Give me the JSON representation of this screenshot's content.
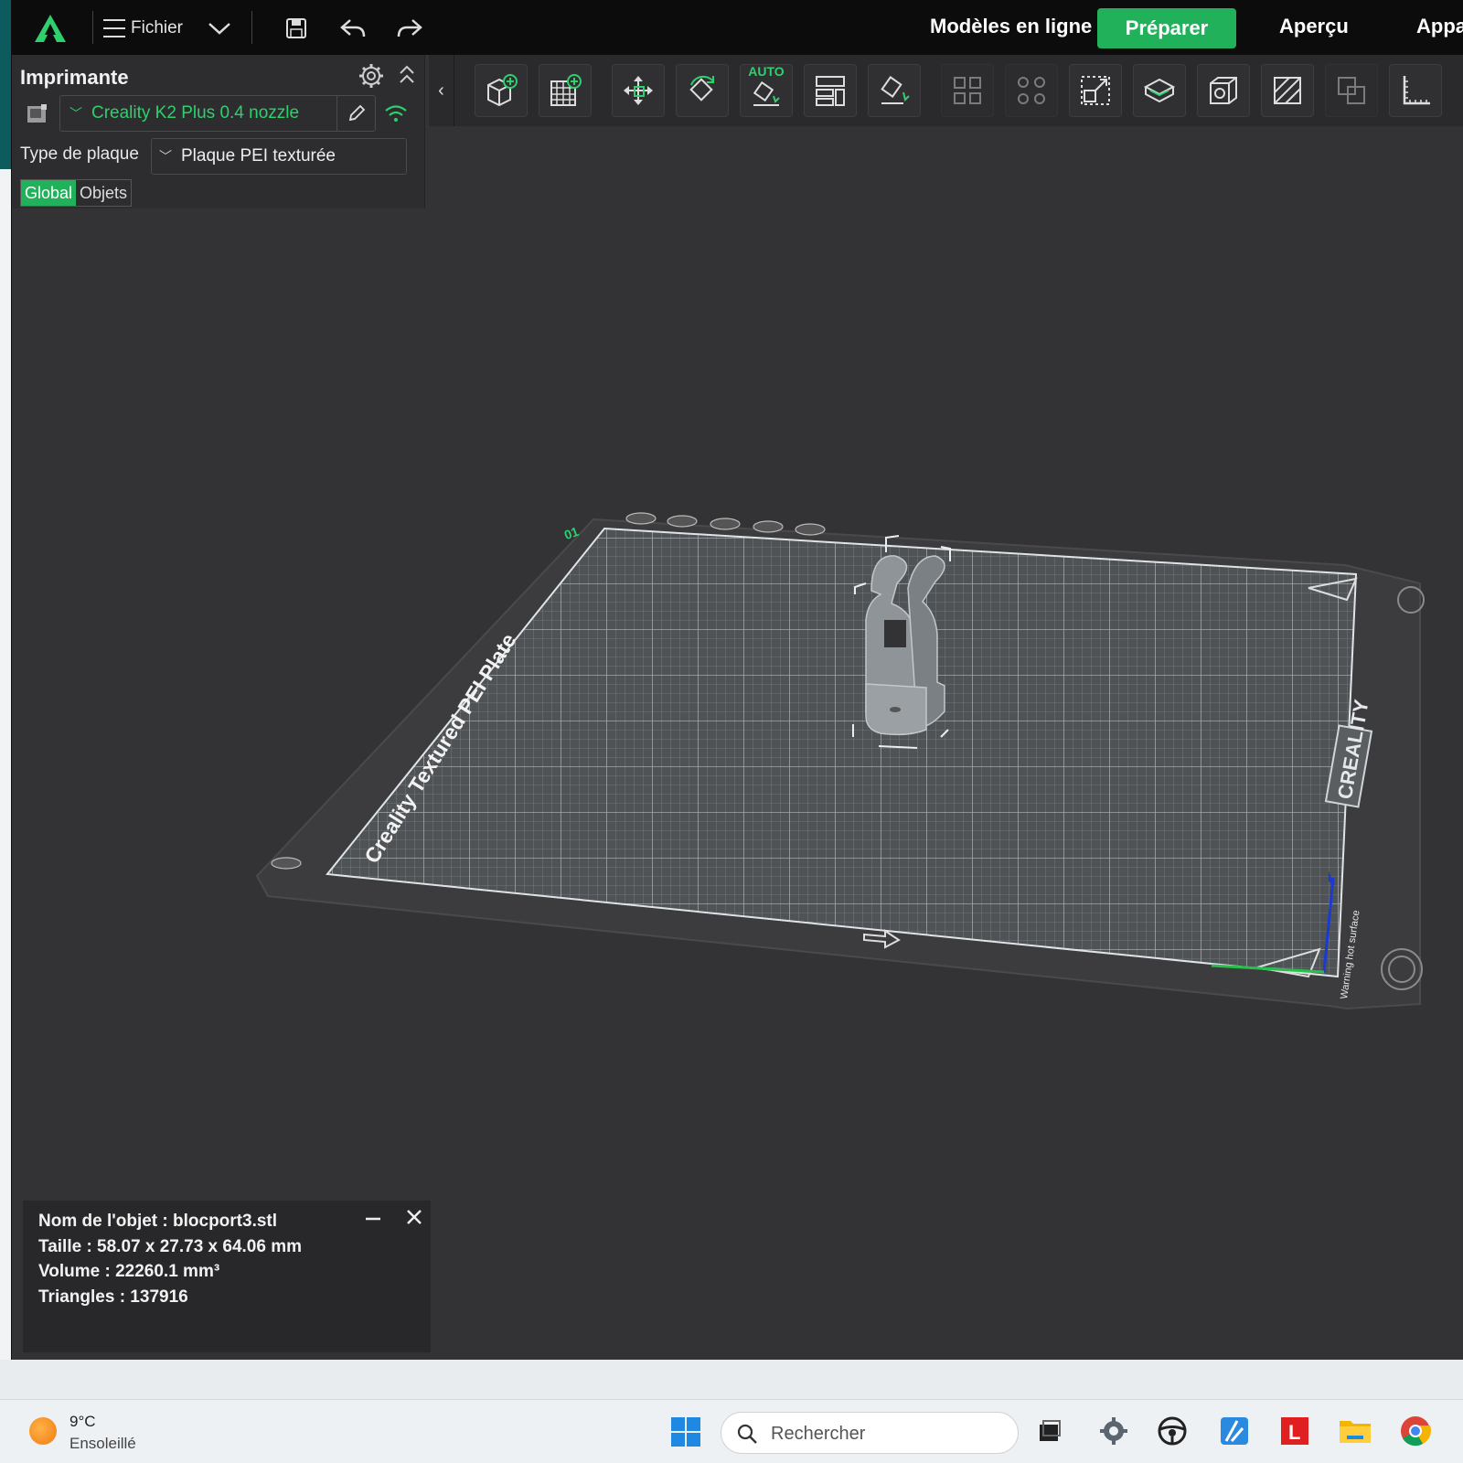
{
  "topbar": {
    "file_menu_label": "Fichier",
    "online_models_label": "Modèles en ligne",
    "prepare_label": "Préparer",
    "preview_label": "Aperçu",
    "device_label": "Appa"
  },
  "left_panel": {
    "title": "Imprimante",
    "printer_name": "Creality K2 Plus 0.4 nozzle",
    "plate_type_label": "Type de plaque",
    "plate_type_value": "Plaque PEI texturée",
    "tabs": [
      "Global",
      "Objets"
    ],
    "active_tab": "Global"
  },
  "toolbar": {
    "auto_label": "AUTO",
    "tools": [
      "add-object",
      "add-plate",
      "move",
      "rotate",
      "auto-orient",
      "arrange",
      "lay-on-face",
      "split-objects",
      "split-parts",
      "scale",
      "cut",
      "hollow",
      "boolean",
      "support-paint",
      "measure"
    ]
  },
  "viewport": {
    "bed_label": "Creality Textured PEI Plate",
    "brand_label": "CREALITY",
    "warning_label": "Warning hot surface"
  },
  "object_info": {
    "name": "Nom de l'objet : blocport3.stl",
    "size": "Taille : 58.07 x 27.73 x 64.06 mm",
    "volume": "Volume : 22260.1 mm³",
    "triangles": "Triangles : 137916"
  },
  "taskbar": {
    "temperature": "9°C",
    "weather": "Ensoleillé",
    "search_placeholder": "Rechercher"
  },
  "colors": {
    "accent": "#20b15a",
    "accent_text": "#2fcf6e",
    "background": "#333335",
    "topbar": "#0c0c0d"
  }
}
